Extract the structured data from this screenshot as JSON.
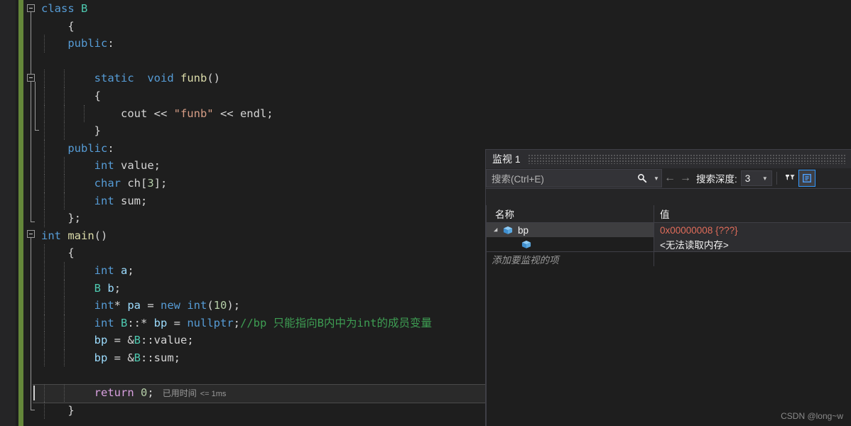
{
  "editor": {
    "lines": [
      {
        "indent": 0,
        "tokens": [
          {
            "t": "class",
            "c": "kw"
          },
          {
            "t": " ",
            "c": "punc"
          },
          {
            "t": "B",
            "c": "type"
          }
        ]
      },
      {
        "indent": 1,
        "tokens": [
          {
            "t": "{",
            "c": "punc"
          }
        ]
      },
      {
        "indent": 1,
        "tokens": [
          {
            "t": "public",
            "c": "kw"
          },
          {
            "t": ":",
            "c": "punc"
          }
        ]
      },
      {
        "indent": 0,
        "tokens": []
      },
      {
        "indent": 2,
        "tokens": [
          {
            "t": "static",
            "c": "kw"
          },
          {
            "t": "  ",
            "c": "punc"
          },
          {
            "t": "void",
            "c": "kw"
          },
          {
            "t": " ",
            "c": "punc"
          },
          {
            "t": "funb",
            "c": "fn"
          },
          {
            "t": "()",
            "c": "punc"
          }
        ]
      },
      {
        "indent": 2,
        "tokens": [
          {
            "t": "{",
            "c": "punc"
          }
        ]
      },
      {
        "indent": 3,
        "tokens": [
          {
            "t": "cout",
            "c": "id"
          },
          {
            "t": " << ",
            "c": "op"
          },
          {
            "t": "\"funb\"",
            "c": "str"
          },
          {
            "t": " << ",
            "c": "op"
          },
          {
            "t": "endl",
            "c": "id"
          },
          {
            "t": ";",
            "c": "punc"
          }
        ]
      },
      {
        "indent": 2,
        "tokens": [
          {
            "t": "}",
            "c": "punc"
          }
        ]
      },
      {
        "indent": 1,
        "tokens": [
          {
            "t": "public",
            "c": "kw"
          },
          {
            "t": ":",
            "c": "punc"
          }
        ]
      },
      {
        "indent": 2,
        "tokens": [
          {
            "t": "int",
            "c": "kw"
          },
          {
            "t": " ",
            "c": "punc"
          },
          {
            "t": "value",
            "c": "id"
          },
          {
            "t": ";",
            "c": "punc"
          }
        ]
      },
      {
        "indent": 2,
        "tokens": [
          {
            "t": "char",
            "c": "kw"
          },
          {
            "t": " ",
            "c": "punc"
          },
          {
            "t": "ch",
            "c": "id"
          },
          {
            "t": "[",
            "c": "punc"
          },
          {
            "t": "3",
            "c": "num"
          },
          {
            "t": "];",
            "c": "punc"
          }
        ]
      },
      {
        "indent": 2,
        "tokens": [
          {
            "t": "int",
            "c": "kw"
          },
          {
            "t": " ",
            "c": "punc"
          },
          {
            "t": "sum",
            "c": "id"
          },
          {
            "t": ";",
            "c": "punc"
          }
        ]
      },
      {
        "indent": 1,
        "tokens": [
          {
            "t": "};",
            "c": "punc"
          }
        ]
      },
      {
        "indent": 0,
        "tokens": [
          {
            "t": "int",
            "c": "kw"
          },
          {
            "t": " ",
            "c": "punc"
          },
          {
            "t": "main",
            "c": "fn"
          },
          {
            "t": "()",
            "c": "punc"
          }
        ]
      },
      {
        "indent": 1,
        "tokens": [
          {
            "t": "{",
            "c": "punc"
          }
        ]
      },
      {
        "indent": 2,
        "tokens": [
          {
            "t": "int",
            "c": "kw"
          },
          {
            "t": " ",
            "c": "punc"
          },
          {
            "t": "a",
            "c": "var"
          },
          {
            "t": ";",
            "c": "punc"
          }
        ]
      },
      {
        "indent": 2,
        "tokens": [
          {
            "t": "B",
            "c": "type"
          },
          {
            "t": " ",
            "c": "punc"
          },
          {
            "t": "b",
            "c": "var"
          },
          {
            "t": ";",
            "c": "punc"
          }
        ]
      },
      {
        "indent": 2,
        "tokens": [
          {
            "t": "int",
            "c": "kw"
          },
          {
            "t": "* ",
            "c": "punc"
          },
          {
            "t": "pa",
            "c": "var"
          },
          {
            "t": " = ",
            "c": "op"
          },
          {
            "t": "new",
            "c": "kw"
          },
          {
            "t": " ",
            "c": "punc"
          },
          {
            "t": "int",
            "c": "kw"
          },
          {
            "t": "(",
            "c": "punc"
          },
          {
            "t": "10",
            "c": "num"
          },
          {
            "t": ");",
            "c": "punc"
          }
        ]
      },
      {
        "indent": 2,
        "tokens": [
          {
            "t": "int",
            "c": "kw"
          },
          {
            "t": " ",
            "c": "punc"
          },
          {
            "t": "B",
            "c": "type"
          },
          {
            "t": "::* ",
            "c": "punc"
          },
          {
            "t": "bp",
            "c": "var"
          },
          {
            "t": " = ",
            "c": "op"
          },
          {
            "t": "nullptr",
            "c": "kw"
          },
          {
            "t": ";",
            "c": "punc"
          },
          {
            "t": "//bp 只能指向B内中为int的成员变量",
            "c": "cmt"
          }
        ]
      },
      {
        "indent": 2,
        "tokens": [
          {
            "t": "bp",
            "c": "var"
          },
          {
            "t": " = &",
            "c": "op"
          },
          {
            "t": "B",
            "c": "type"
          },
          {
            "t": "::",
            "c": "punc"
          },
          {
            "t": "value",
            "c": "id"
          },
          {
            "t": ";",
            "c": "punc"
          }
        ]
      },
      {
        "indent": 2,
        "tokens": [
          {
            "t": "bp",
            "c": "var"
          },
          {
            "t": " = &",
            "c": "op"
          },
          {
            "t": "B",
            "c": "type"
          },
          {
            "t": "::",
            "c": "punc"
          },
          {
            "t": "sum",
            "c": "id"
          },
          {
            "t": ";",
            "c": "punc"
          }
        ]
      },
      {
        "indent": 0,
        "tokens": []
      },
      {
        "indent": 2,
        "exec": true,
        "tokens": [
          {
            "t": "return",
            "c": "kw2"
          },
          {
            "t": " ",
            "c": "punc"
          },
          {
            "t": "0",
            "c": "num"
          },
          {
            "t": ";",
            "c": "punc"
          }
        ]
      },
      {
        "indent": 1,
        "tokens": [
          {
            "t": "}",
            "c": "punc"
          }
        ]
      }
    ],
    "elapsed_label": "已用时间",
    "elapsed_value": "<= 1ms"
  },
  "watch": {
    "title": "监视 1",
    "search_placeholder": "搜索(Ctrl+E)",
    "depth_label": "搜索深度:",
    "depth_value": "3",
    "columns": [
      "名称",
      "值"
    ],
    "rows": [
      {
        "name": "bp",
        "value": "0x00000008 {???}",
        "expander": "▲",
        "icon": "object-cube-icon",
        "indent": 0,
        "selected": true,
        "changed": true
      },
      {
        "name": "",
        "value": "<无法读取内存>",
        "expander": "",
        "icon": "object-cube-icon",
        "indent": 1,
        "selected": false,
        "changed": false
      }
    ],
    "add_item_placeholder": "添加要监视的项"
  },
  "watermark": "CSDN @long~w",
  "colors": {
    "editor_bg": "#1e1e1e",
    "panel_bg": "#252526",
    "change_bar": "#64873a",
    "accent": "#3399ff",
    "value_changed": "#e06c5a",
    "comment": "#3e9e53"
  }
}
